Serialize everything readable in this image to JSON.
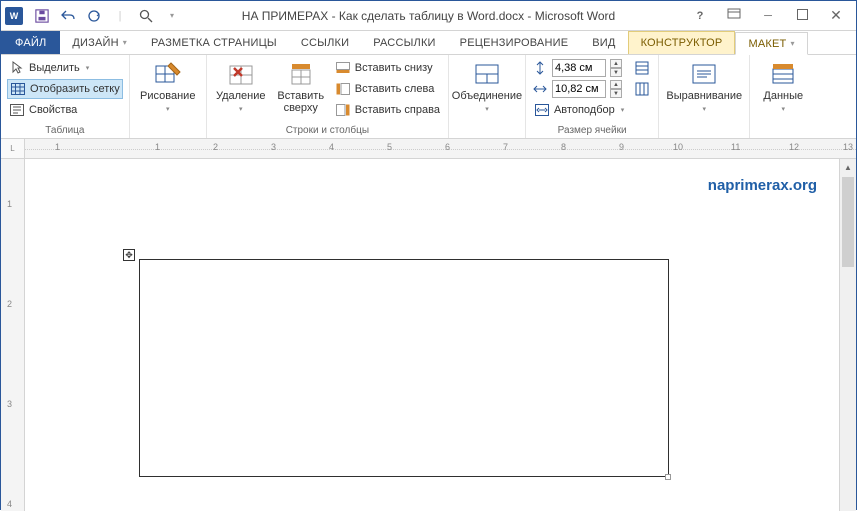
{
  "title": "НА ПРИМЕРАХ - Как сделать таблицу в Word.docx - Microsoft Word",
  "watermark": "naprimerax.org",
  "tabs": {
    "file": "ФАЙЛ",
    "design": "ДИЗАЙН",
    "layout": "РАЗМЕТКА СТРАНИЦЫ",
    "references": "ССЫЛКИ",
    "mailings": "РАССЫЛКИ",
    "review": "РЕЦЕНЗИРОВАНИЕ",
    "view": "ВИД",
    "constructor": "КОНСТРУКТОР",
    "maket": "МАКЕТ"
  },
  "ribbon": {
    "table": {
      "label": "Таблица",
      "select": "Выделить",
      "show_grid": "Отобразить сетку",
      "properties": "Свойства"
    },
    "draw": {
      "drawing": "Рисование"
    },
    "rows_cols": {
      "label": "Строки и столбцы",
      "delete": "Удаление",
      "insert_top": "Вставить сверху",
      "insert_bottom": "Вставить снизу",
      "insert_left": "Вставить слева",
      "insert_right": "Вставить справа"
    },
    "merge": {
      "label": "Объединение"
    },
    "cell_size": {
      "label": "Размер ячейки",
      "height": "4,38 см",
      "width": "10,82 см",
      "autofit": "Автоподбор"
    },
    "align": {
      "label": "Выравнивание"
    },
    "data": {
      "label": "Данные"
    }
  },
  "ruler_h": [
    "1",
    "1",
    "2",
    "3",
    "4",
    "5",
    "6",
    "7",
    "8",
    "9",
    "10",
    "11",
    "12",
    "13"
  ],
  "ruler_v": [
    "1",
    "2",
    "3",
    "4"
  ]
}
